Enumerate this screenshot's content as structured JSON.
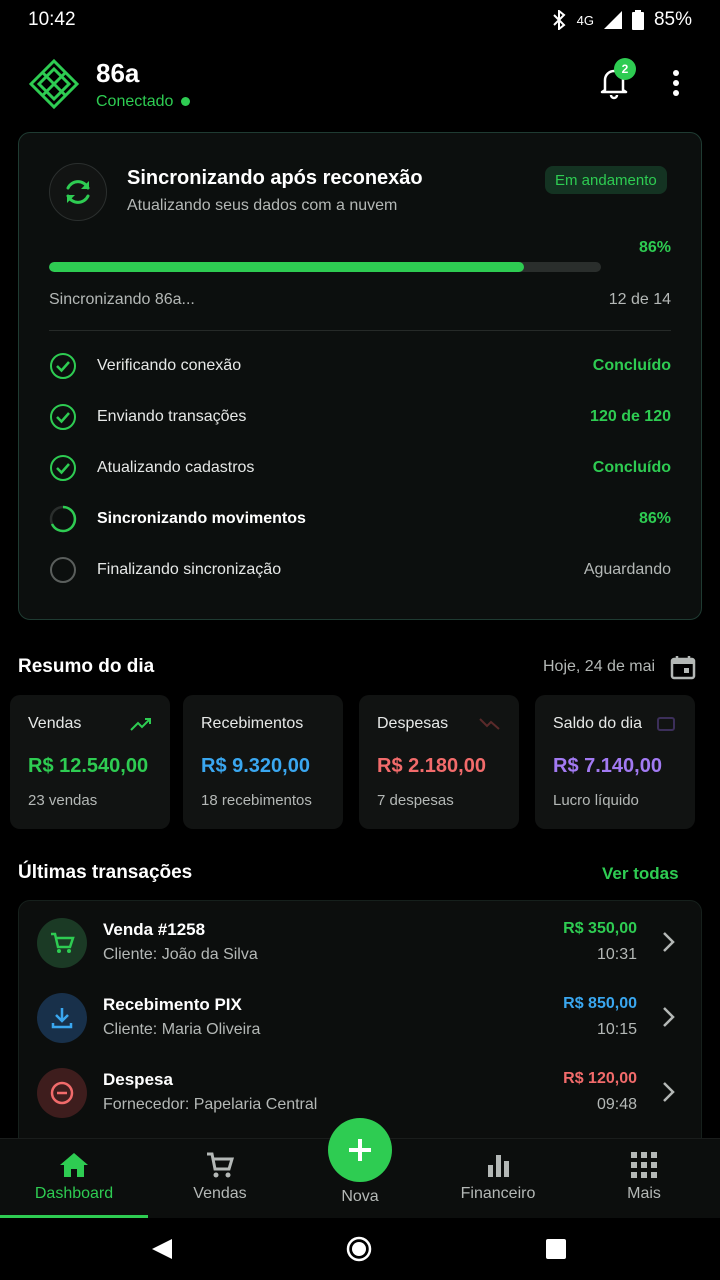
{
  "status_bar": {
    "time": "10:42",
    "network": "4G",
    "battery": "85%"
  },
  "header": {
    "title": "86a",
    "status": "Conectado",
    "notification_count": "2"
  },
  "sync": {
    "title": "Sincronizando após reconexão",
    "subtitle": "Atualizando seus dados com a nuvem",
    "badge": "Em andamento",
    "percent": "86%",
    "progress": 0.86,
    "current": "Sincronizando 86a...",
    "count": "12 de 14",
    "steps": [
      {
        "label": "Verificando conexão",
        "status": "Concluído"
      },
      {
        "label": "Enviando transações",
        "status": "120 de 120"
      },
      {
        "label": "Atualizando cadastros",
        "status": "Concluído"
      },
      {
        "label": "Sincronizando movimentos",
        "status": "86%"
      },
      {
        "label": "Finalizando sincronização",
        "status": "Aguardando"
      }
    ]
  },
  "summary": {
    "title": "Resumo do dia",
    "date": "Hoje, 24 de mai",
    "cards": [
      {
        "label": "Vendas",
        "value": "R$ 12.540,00",
        "sub": "23 vendas",
        "color": "#2ecc52"
      },
      {
        "label": "Recebimentos",
        "value": "R$ 9.320,00",
        "sub": "18 recebimentos",
        "color": "#3aa7f0"
      },
      {
        "label": "Despesas",
        "value": "R$ 2.180,00",
        "sub": "7 despesas",
        "color": "#f26b6b"
      },
      {
        "label": "Saldo do dia",
        "value": "R$ 7.140,00",
        "sub": "Lucro líquido",
        "color": "#a27af2"
      }
    ]
  },
  "transactions": {
    "title": "Últimas transações",
    "see_all": "Ver todas",
    "items": [
      {
        "title": "Venda #1258",
        "sub": "Cliente: João da Silva",
        "amount": "R$ 350,00",
        "time": "10:31"
      },
      {
        "title": "Recebimento PIX",
        "sub": "Cliente: Maria Oliveira",
        "amount": "R$ 850,00",
        "time": "10:15"
      },
      {
        "title": "Despesa",
        "sub": "Fornecedor: Papelaria Central",
        "amount": "R$ 120,00",
        "time": "09:48"
      }
    ]
  },
  "nav": {
    "dashboard": "Dashboard",
    "vendas": "Vendas",
    "nova": "Nova",
    "financeiro": "Financeiro",
    "mais": "Mais"
  }
}
